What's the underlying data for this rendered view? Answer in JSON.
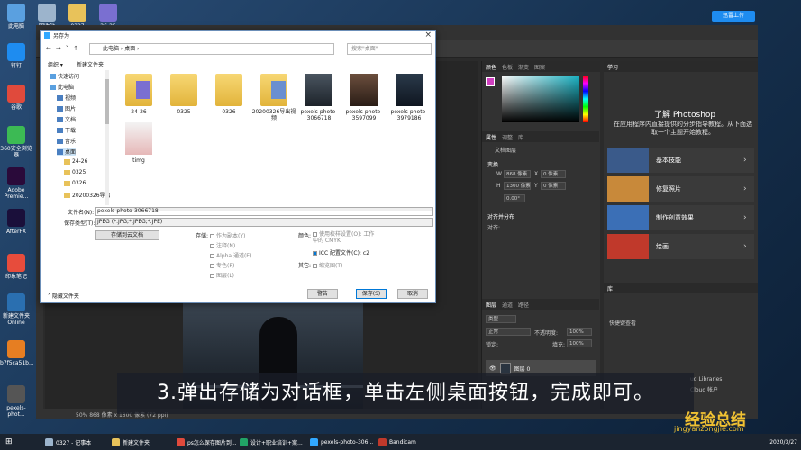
{
  "desktop": {
    "icons": [
      {
        "label": "此电脑",
        "color": "#5aa0e0"
      },
      {
        "label": "回收站",
        "color": "#9cb4cc"
      },
      {
        "label": "0327",
        "color": "#e8c25a"
      },
      {
        "label": "26-25",
        "color": "#7a6fd1"
      },
      {
        "label": "钉钉",
        "color": "#1e8cf0"
      },
      {
        "label": "谷歌",
        "color": "#e04a3c"
      },
      {
        "label": "360安全浏览器",
        "color": "#3cba54"
      },
      {
        "label": "Adobe Premie...",
        "color": "#2a0a3a"
      },
      {
        "label": "AfterFX",
        "color": "#1a0f3a"
      },
      {
        "label": "印象笔记",
        "color": "#e74c3c"
      },
      {
        "label": "新建文件夹 Online",
        "color": "#2a6fb0"
      },
      {
        "label": "b7f5ca51b...",
        "color": "#e67e22"
      },
      {
        "label": "pexels-phot...",
        "color": "#555"
      }
    ],
    "blue_button": "迅雷上传"
  },
  "photoshop": {
    "status": "50%    868 像素 x 1300 像素 (72 ppi)",
    "color_tabs": [
      "颜色",
      "色板",
      "渐变",
      "图案"
    ],
    "properties_tabs": [
      "属性",
      "调整",
      "库"
    ],
    "doc_label": "文档图层",
    "transform": "变换",
    "w_label": "W",
    "w_value": "868 像素",
    "x_label": "X",
    "x_value": "0 像素",
    "h_label": "H",
    "h_value": "1300 像素",
    "y_label": "Y",
    "y_value": "0 像素",
    "angle": "0.00°",
    "align_label": "对齐并分布",
    "align_sub": "对齐:",
    "layers_tabs": [
      "图层",
      "通道",
      "路径"
    ],
    "layer_kind": "类型",
    "blend": "正常",
    "opacity_label": "不透明度:",
    "opacity": "100%",
    "lock_label": "锁定:",
    "fill_label": "填充:",
    "fill": "100%",
    "layer_name": "图层 0",
    "right_tab": "学习",
    "learn_title": "了解 Photoshop",
    "learn_desc": "在应用程序内直接提供的分步指导教程。从下面选取一个主题开始教程。",
    "cards": [
      {
        "title": "基本技能",
        "color": "#3a5a8a"
      },
      {
        "title": "修复照片",
        "color": "#c8893a"
      },
      {
        "title": "制作创意效果",
        "color": "#3b6fb6"
      },
      {
        "title": "绘画",
        "color": "#c0392b"
      }
    ],
    "bottom_tab": "库",
    "bottom_label": "快捷键查看",
    "lib_text": "ud Libraries",
    "lib_text2": "Cloud 帐户"
  },
  "dialog": {
    "title": "另存为",
    "address": "此电脑  ›  桌面  ›",
    "search_placeholder": "搜索\"桌面\"",
    "organize": "组织 ▾",
    "new_folder": "新建文件夹",
    "nav": [
      {
        "label": "快速访问",
        "level": 0
      },
      {
        "label": "此电脑",
        "level": 0
      },
      {
        "label": "视频",
        "level": 1
      },
      {
        "label": "图片",
        "level": 1
      },
      {
        "label": "文档",
        "level": 1
      },
      {
        "label": "下载",
        "level": 1
      },
      {
        "label": "音乐",
        "level": 1
      },
      {
        "label": "桌面",
        "level": 1,
        "selected": true
      },
      {
        "label": "24-26",
        "level": 2
      },
      {
        "label": "0325",
        "level": 2
      },
      {
        "label": "0326",
        "level": 2
      },
      {
        "label": "20200326导出",
        "level": 2
      }
    ],
    "files": [
      {
        "name": "24-26",
        "kind": "folder-purple"
      },
      {
        "name": "0325",
        "kind": "folder"
      },
      {
        "name": "0326",
        "kind": "folder"
      },
      {
        "name": "20200326导出视频",
        "kind": "folder-blue"
      },
      {
        "name": "pexels-photo-3066718",
        "kind": "photo1"
      },
      {
        "name": "pexels-photo-3597099",
        "kind": "photo2"
      },
      {
        "name": "pexels-photo-3979186",
        "kind": "photo3"
      },
      {
        "name": "timg",
        "kind": "card"
      }
    ],
    "filename_label": "文件名(N):",
    "filename_value": "pexels-photo-3066718",
    "filetype_label": "保存类型(T):",
    "filetype_value": "JPEG (*.JPG;*.JPEG;*.JPE)",
    "cloud_button": "存储到云文档",
    "save_label": "存储:",
    "opt_copy": "作为副本(Y)",
    "opt_notes": "注释(N)",
    "opt_alpha": "Alpha 通道(E)",
    "opt_spot": "专色(P)",
    "opt_layers": "图层(L)",
    "color_label": "颜色:",
    "opt_proof": "使用校样设置(O): 工作中的 CMYK",
    "opt_icc": "ICC 配置文件(C): c2",
    "other_label": "其它:",
    "opt_thumb": "缩览图(T)",
    "hide_folders": "隐藏文件夹",
    "btn_warn": "警告",
    "btn_save": "保存(S)",
    "btn_cancel": "取消"
  },
  "subtitle": "3.弹出存储为对话框，单击左侧桌面按钮，完成即可。",
  "watermark": "经验总结",
  "watermark_url": "jingyanzongjie.com",
  "taskbar": {
    "items": [
      {
        "label": "0327 - 记事本",
        "color": "#9cb4cc"
      },
      {
        "label": "新建文件夹",
        "color": "#e8c25a"
      },
      {
        "label": "ps怎么保存图片到...",
        "color": "#e04a3c"
      },
      {
        "label": "设计+职业培训+案...",
        "color": "#21a366"
      },
      {
        "label": "pexels-photo-306...",
        "color": "#31a8ff"
      },
      {
        "label": "Bandicam",
        "color": "#c0392b"
      }
    ],
    "clock": "2020/3/27"
  }
}
